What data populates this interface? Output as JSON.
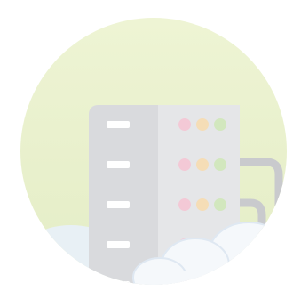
{
  "illustration": {
    "subject": "server-rack-with-cloud",
    "colors": {
      "background": "#ffffff",
      "circle_top": "#eef4d4",
      "circle_bottom": "#e4edc6",
      "bottom_cloud": "#e8f0f5",
      "rack_left": "#d9dadd",
      "rack_right": "#e5e6e8",
      "slot": "#ffffff",
      "cable": "#c9cacd",
      "led_red": "#f3c9d6",
      "led_orange": "#f5ddb6",
      "led_green": "#d2e7be",
      "cloud": "#f5f8fb",
      "cloud_outline": "#dfe8f2"
    },
    "rows": 5,
    "leds_per_row": 3
  }
}
